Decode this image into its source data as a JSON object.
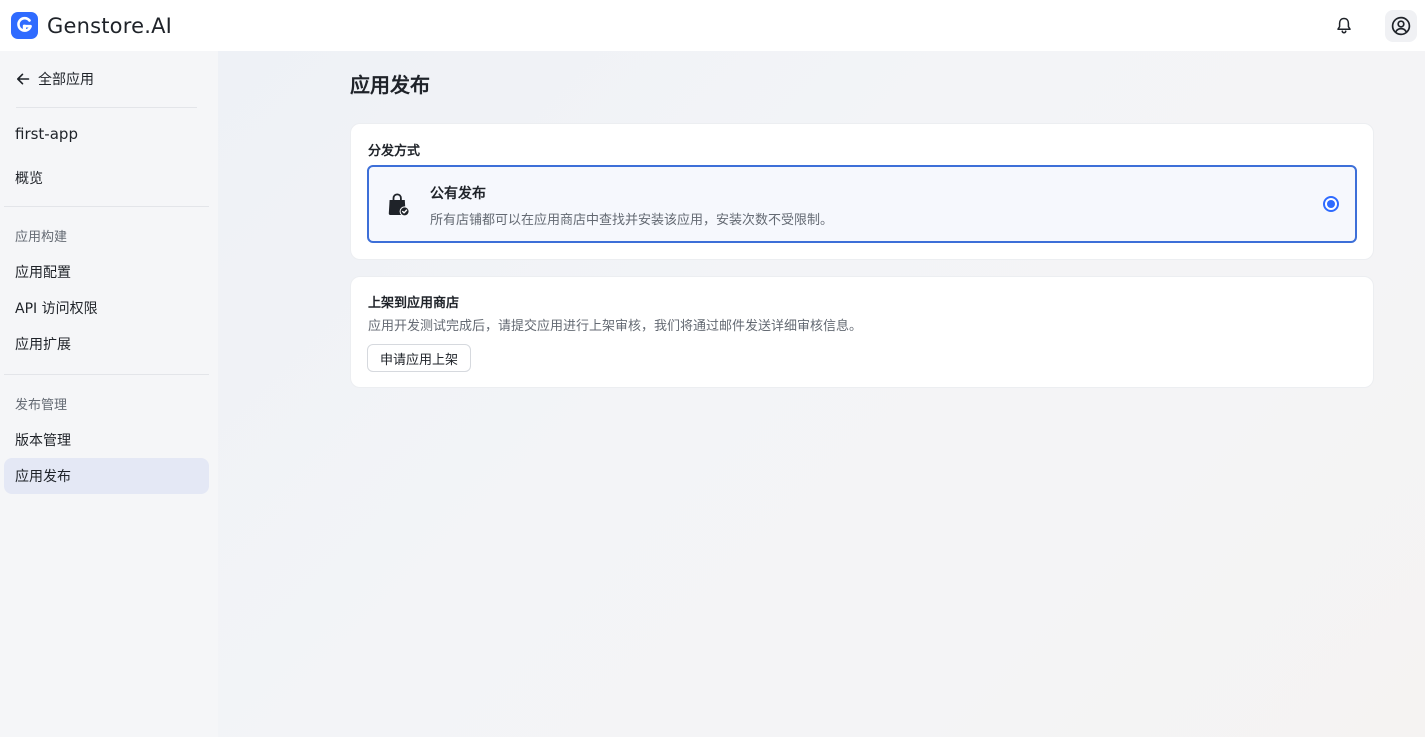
{
  "header": {
    "brand_name": "Genstore.AI",
    "icons": {
      "logo": "genstore-logo",
      "notifications": "bell-icon",
      "account": "user-circle-icon"
    }
  },
  "sidebar": {
    "back_label": "全部应用",
    "app_name": "first-app",
    "overview_label": "概览",
    "sections": [
      {
        "label": "应用构建",
        "items": [
          "应用配置",
          "API 访问权限",
          "应用扩展"
        ]
      },
      {
        "label": "发布管理",
        "items": [
          "版本管理",
          "应用发布"
        ]
      }
    ],
    "active_item": "应用发布"
  },
  "main": {
    "page_title": "应用发布",
    "distribution": {
      "label": "分发方式",
      "option_title": "公有发布",
      "option_desc": "所有店铺都可以在应用商店中查找并安装该应用，安装次数不受限制。",
      "selected": true
    },
    "listing": {
      "title": "上架到应用商店",
      "desc": "应用开发测试完成后，请提交应用进行上架审核，我们将通过邮件发送详细审核信息。",
      "button_label": "申请应用上架"
    }
  },
  "colors": {
    "accent": "#2f6bff",
    "active_nav_bg": "#e4e8f5",
    "selected_border": "#3d6fd8"
  }
}
